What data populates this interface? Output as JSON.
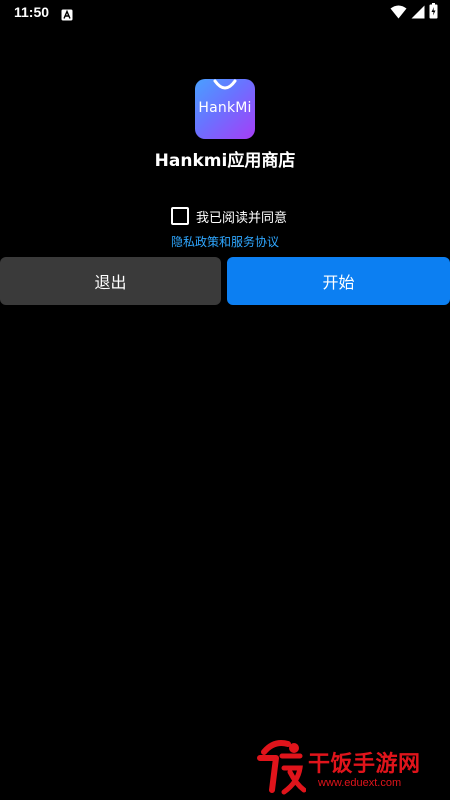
{
  "status_bar": {
    "time": "11:50",
    "notification_icon": "notification-a-icon",
    "icons": [
      "wifi-icon",
      "signal-icon",
      "battery-icon"
    ]
  },
  "app": {
    "icon_label": "HankMi",
    "name": "Hankmi应用商店",
    "icon_gradient": [
      "#49a0ff",
      "#6a72ff",
      "#a63df7"
    ]
  },
  "agreement": {
    "checkbox_label": "我已阅读并同意",
    "checked": false,
    "policy_link": "隐私政策和服务协议"
  },
  "buttons": {
    "exit_label": "退出",
    "start_label": "开始"
  },
  "watermark": {
    "title": "干饭手游网",
    "url": "www.eduext.com"
  },
  "colors": {
    "background": "#000000",
    "primary": "#0c7ff2",
    "secondary_button": "#3a3a3a",
    "link": "#2fa7ff",
    "watermark": "#e0141b"
  }
}
